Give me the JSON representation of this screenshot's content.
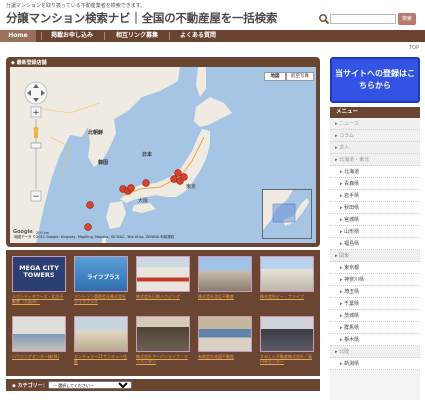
{
  "header": {
    "tagline": "分譲マンションを取り扱っている不動産業者を検索できます。",
    "title": "分譲マンション検索ナビ｜全国の不動産屋を一括検索",
    "search_placeholder": "",
    "search_button": "検索"
  },
  "nav": {
    "items": [
      "Home",
      "掲載お申し込み",
      "相互リンク募集",
      "よくある質問"
    ]
  },
  "top_link": "TOP",
  "map": {
    "heading": "最新登録店舗",
    "type_buttons": [
      "地図",
      "航空写真"
    ],
    "google": "Google",
    "scale": "200 km",
    "copyright": "地図データ ©2011 Google, Kingway, MapKing, Mapabc, SK M&C, Tele Atlas, ZENRIN 利用規約",
    "labels": [
      "北朝鮮",
      "韓国",
      "日本",
      "大阪",
      "東京"
    ]
  },
  "thumbnails": [
    {
      "caption": "メガシティタワーズ・北谷不動産（大阪市）",
      "img_text": "MEGA CITY TOWERS"
    },
    {
      "caption": "マンション管理会社株式会社ライフプラス",
      "img_text": "ライフプラス"
    },
    {
      "caption": "株式会社日興ハウジング",
      "img_text": ""
    },
    {
      "caption": "株式会社北広不動産",
      "img_text": ""
    },
    {
      "caption": "株式会社ビー・ファイブ",
      "img_text": ""
    },
    {
      "caption": "ハウジングセンター緑(株)",
      "img_text": ""
    },
    {
      "caption": "センチュリー21サンキュー住販",
      "img_text": ""
    },
    {
      "caption": "株式会社アーバンライフ・マンハッタン",
      "img_text": ""
    },
    {
      "caption": "有限会社花園不動産",
      "img_text": ""
    },
    {
      "caption": "すみしん不動産株式会社／高円寺センター",
      "img_text": ""
    }
  ],
  "category": {
    "label": "カテゴリー：",
    "selected": "－ 選択してください －"
  },
  "register_banner": "当サイトへの登録はこちらから",
  "menu": {
    "heading": "メニュー",
    "items": [
      {
        "label": "ニュース",
        "level": 1
      },
      {
        "label": "コラム",
        "level": 1
      },
      {
        "label": "求人",
        "level": 1
      },
      {
        "label": "北海道・東北",
        "level": 1
      },
      {
        "label": "北海道",
        "level": 2
      },
      {
        "label": "青森県",
        "level": 2
      },
      {
        "label": "岩手県",
        "level": 2
      },
      {
        "label": "秋田県",
        "level": 2
      },
      {
        "label": "宮城県",
        "level": 2
      },
      {
        "label": "山形県",
        "level": 2
      },
      {
        "label": "福島県",
        "level": 2
      },
      {
        "label": "関東",
        "level": 1
      },
      {
        "label": "東京都",
        "level": 2
      },
      {
        "label": "神奈川県",
        "level": 2
      },
      {
        "label": "埼玉県",
        "level": 2
      },
      {
        "label": "千葉県",
        "level": 2
      },
      {
        "label": "茨城県",
        "level": 2
      },
      {
        "label": "群馬県",
        "level": 2
      },
      {
        "label": "栃木県",
        "level": 2
      },
      {
        "label": "北陸",
        "level": 1
      },
      {
        "label": "新潟県",
        "level": 2
      }
    ]
  },
  "colors": {
    "brown": "#6a4532",
    "nav": "#6b4331",
    "accent_orange": "#e7a44f",
    "banner_blue": "#3253e6"
  }
}
